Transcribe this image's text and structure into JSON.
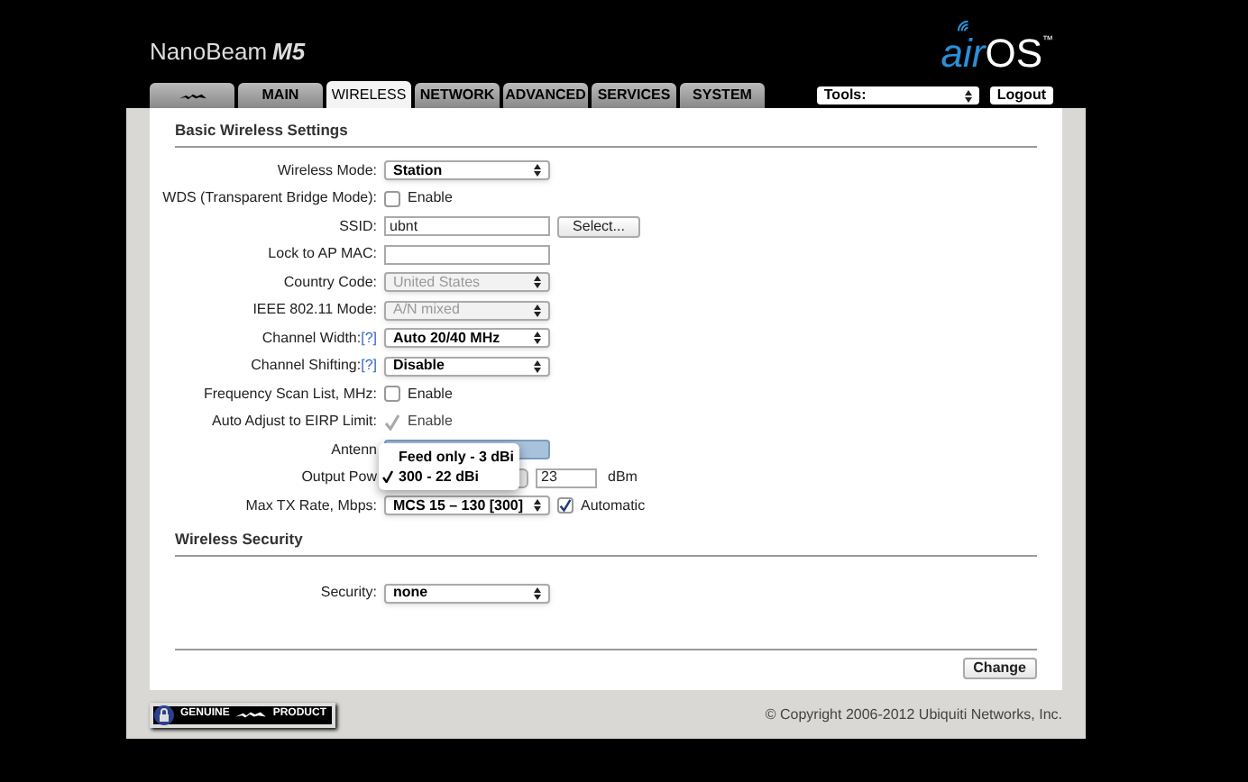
{
  "header": {
    "product": "NanoBeam",
    "model": "M5",
    "logo_air": "air",
    "logo_os": "OS",
    "logo_tm": "™"
  },
  "tabs": [
    {
      "kind": "logo",
      "selected": false
    },
    {
      "kind": "text",
      "label": "MAIN",
      "selected": false
    },
    {
      "kind": "text",
      "label": "WIRELESS",
      "selected": true
    },
    {
      "kind": "text",
      "label": "NETWORK",
      "selected": false
    },
    {
      "kind": "text",
      "label": "ADVANCED",
      "selected": false
    },
    {
      "kind": "text",
      "label": "SERVICES",
      "selected": false
    },
    {
      "kind": "text",
      "label": "SYSTEM",
      "selected": false
    }
  ],
  "tools": {
    "value": "Tools:"
  },
  "logout": "Logout",
  "sections": [
    {
      "title": "Basic Wireless Settings",
      "rows": [
        {
          "kind": "select",
          "label": "Wireless Mode:",
          "value": "Station",
          "disabled": false
        },
        {
          "kind": "checkbox",
          "label": "WDS (Transparent Bridge Mode):",
          "text": "Enable",
          "checked": false,
          "disabled": false
        },
        {
          "kind": "input-button",
          "label": "SSID:",
          "value": "ubnt",
          "button": "Select..."
        },
        {
          "kind": "input",
          "label": "Lock to AP MAC:"
        },
        {
          "kind": "select",
          "label": "Country Code:",
          "value": "United States",
          "disabled": true
        },
        {
          "kind": "select",
          "label": "IEEE 802.11 Mode:",
          "value": "A/N mixed",
          "disabled": true
        },
        {
          "kind": "select",
          "label": "Channel Width:",
          "help": "[?]",
          "value": "Auto 20/40 MHz",
          "disabled": false
        },
        {
          "kind": "select",
          "label": "Channel Shifting:",
          "help": "[?]",
          "value": "Disable",
          "disabled": false
        },
        {
          "kind": "checkbox",
          "label": "Frequency Scan List, MHz:",
          "text": "Enable",
          "checked": false,
          "disabled": false
        },
        {
          "kind": "checkbox",
          "label": "Auto Adjust to EIRP Limit:",
          "text": "Enable",
          "checked": true,
          "disabled": true
        },
        {
          "kind": "covered-select",
          "label": "Antenn"
        },
        {
          "kind": "power",
          "label": "Output Pow",
          "value": "23",
          "unit": "dBm"
        },
        {
          "kind": "select-checkbox",
          "label": "Max TX Rate, Mbps:",
          "value": "MCS 15 – 130 [300]",
          "disabled": false,
          "text": "Automatic",
          "checked": true
        }
      ]
    },
    {
      "title": "Wireless Security",
      "rows": [
        {
          "kind": "select",
          "label": "Security:",
          "value": "none",
          "disabled": false
        }
      ]
    }
  ],
  "antenna_menu": [
    {
      "label": "Feed only - 3 dBi",
      "selected": false
    },
    {
      "label": "300 - 22 dBi",
      "selected": true
    }
  ],
  "change_button": "Change",
  "footer": {
    "badge_left": "GENUINE",
    "badge_right": "PRODUCT",
    "copyright": "© Copyright 2006-2012 Ubiquiti Networks, Inc."
  }
}
